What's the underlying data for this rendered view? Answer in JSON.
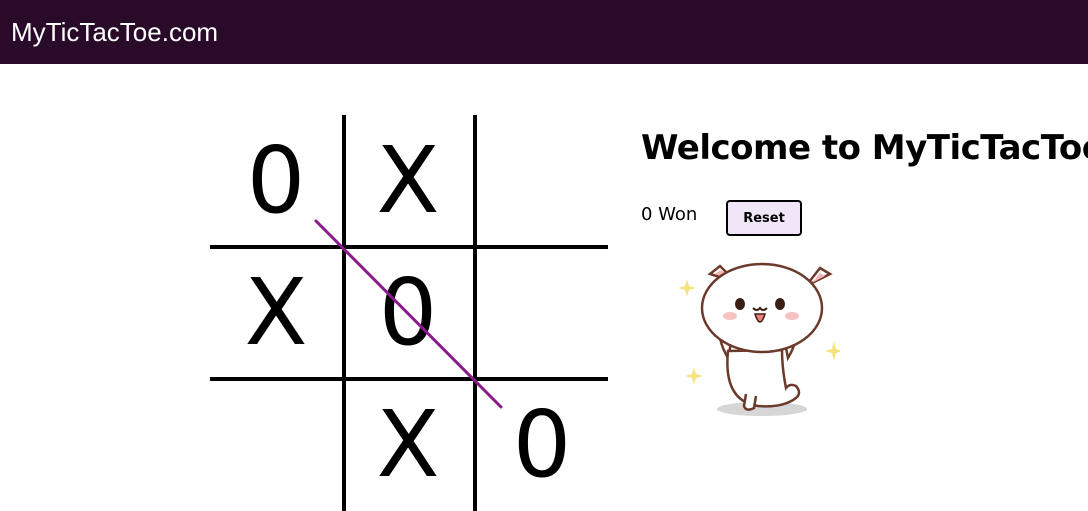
{
  "header": {
    "site_title": "MyTicTacToe.com"
  },
  "board": {
    "cells": [
      [
        "0",
        "X",
        ""
      ],
      [
        "X",
        "0",
        ""
      ],
      [
        "",
        "X",
        "0"
      ]
    ],
    "winning_line": "diagonal",
    "win_line_color": "#8b1a8b"
  },
  "main": {
    "welcome_title": "Welcome to MyTicTacToe",
    "won_text": "0 Won",
    "reset_label": "Reset"
  },
  "celebration": {
    "icon": "dancing-cat-icon"
  },
  "colors": {
    "header_bg": "#2a0a29",
    "reset_bg": "#f1e6f7"
  }
}
